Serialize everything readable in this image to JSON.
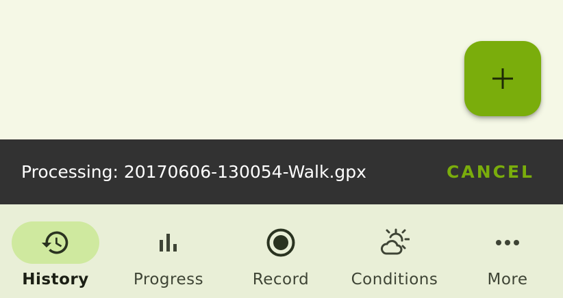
{
  "fab": {
    "icon": "plus-icon"
  },
  "snackbar": {
    "message": "Processing: 20170606-130054-Walk.gpx",
    "action_label": "CANCEL"
  },
  "bottom_nav": {
    "items": [
      {
        "label": "History",
        "icon": "history-icon",
        "active": true
      },
      {
        "label": "Progress",
        "icon": "bar-chart-icon",
        "active": false
      },
      {
        "label": "Record",
        "icon": "record-icon",
        "active": false
      },
      {
        "label": "Conditions",
        "icon": "weather-icon",
        "active": false
      },
      {
        "label": "More",
        "icon": "more-horizontal-icon",
        "active": false
      }
    ]
  },
  "colors": {
    "accent": "#7aad0c",
    "active_pill": "#cfe99f",
    "snackbar_bg": "#323232",
    "nav_bg": "#e9efd7",
    "background": "#f5f8e6"
  }
}
